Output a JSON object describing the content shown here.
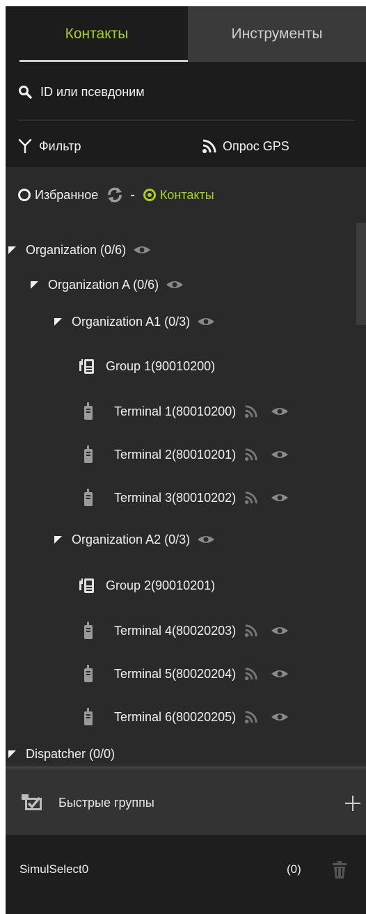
{
  "tabs": [
    {
      "label": "Контакты",
      "active": true
    },
    {
      "label": "Инструменты",
      "active": false
    }
  ],
  "search": {
    "placeholder": "ID или псевдоним"
  },
  "toolbar": {
    "filter_label": "Фильтр",
    "gps_label": "Опрос GPS"
  },
  "view_mode": {
    "favorites_label": "Избранное",
    "separator": "-",
    "contacts_label": "Контакты",
    "selected": "contacts"
  },
  "tree": [
    {
      "type": "org",
      "label": "Organization (0/6)",
      "eye": true
    },
    {
      "type": "org",
      "label": "Organization A (0/6)",
      "eye": true
    },
    {
      "type": "org",
      "label": "Organization A1 (0/3)",
      "eye": true
    },
    {
      "type": "group",
      "label": "Group 1(90010200)"
    },
    {
      "type": "terminal",
      "label": "Terminal 1(80010200)"
    },
    {
      "type": "terminal",
      "label": "Terminal 2(80010201)"
    },
    {
      "type": "terminal",
      "label": "Terminal 3(80010202)"
    },
    {
      "type": "org",
      "label": "Organization A2 (0/3)",
      "eye": true
    },
    {
      "type": "group",
      "label": "Group 2(90010201)"
    },
    {
      "type": "terminal",
      "label": "Terminal 4(80020203)"
    },
    {
      "type": "terminal",
      "label": "Terminal 5(80020204)"
    },
    {
      "type": "terminal",
      "label": "Terminal 6(80020205)"
    },
    {
      "type": "org",
      "label": "Dispatcher (0/0)",
      "eye": false
    }
  ],
  "quick_groups": {
    "label": "Быстрые группы"
  },
  "simul_select": {
    "name": "SimulSelect0",
    "count": "(0)"
  },
  "colors": {
    "accent": "#a8d11b",
    "panel": "#2a2a2a",
    "header": "#1c1c1c"
  }
}
